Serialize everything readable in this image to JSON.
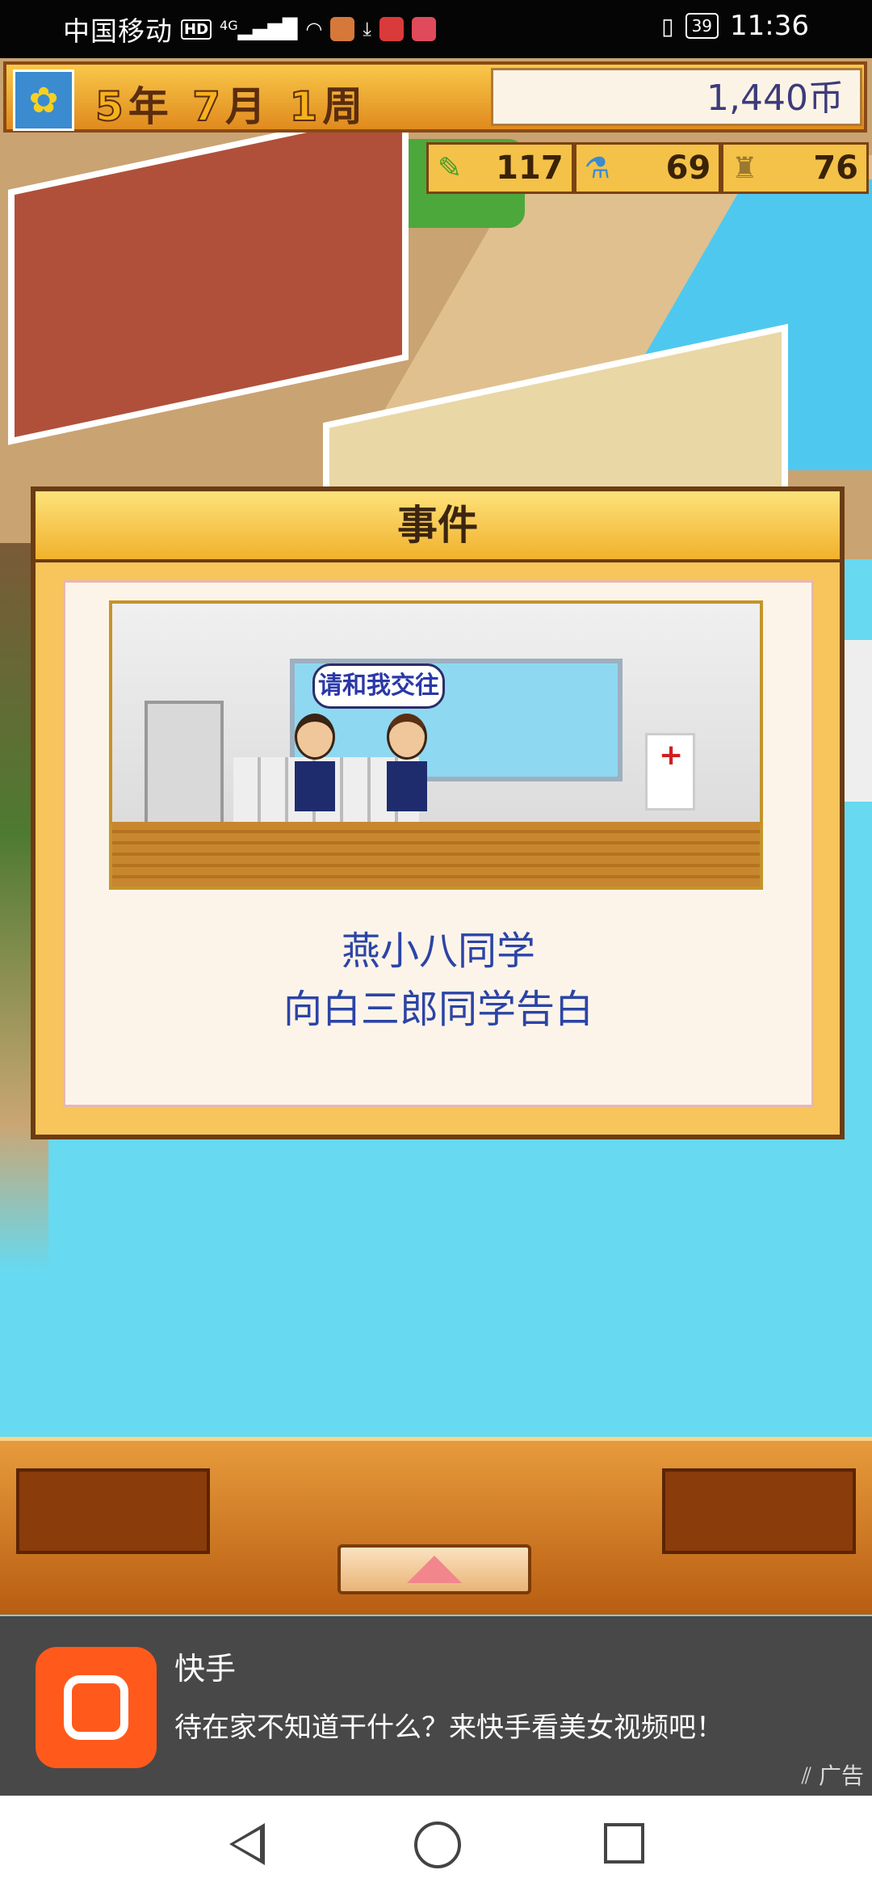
{
  "status_bar": {
    "carrier": "中国移动",
    "hd": "HD",
    "network": "4G",
    "battery": "39",
    "time": "11:36"
  },
  "top_bar": {
    "year": "5",
    "year_unit": "年",
    "month": "7",
    "month_unit": "月",
    "week": "1",
    "week_unit": "周",
    "money": "1,440币",
    "sun_icon": "sunflower-icon"
  },
  "stats": [
    {
      "icon": "pencil-icon",
      "value": "117"
    },
    {
      "icon": "flask-icon",
      "value": "69"
    },
    {
      "icon": "trophy-icon",
      "value": "76"
    }
  ],
  "event_dialog": {
    "title": "事件",
    "speech_bubble": "请和我交往",
    "text_line1": "燕小八同学",
    "text_line2": "向白三郎同学告白"
  },
  "ad": {
    "title": "快手",
    "description": "待在家不知道干什么？来快手看美女视频吧！",
    "tag": "广告"
  },
  "colors": {
    "dialog_frame": "#f7c55b",
    "event_text": "#2b44a6",
    "sea": "#67d9f0",
    "ad_logo": "#ff5a1c"
  }
}
